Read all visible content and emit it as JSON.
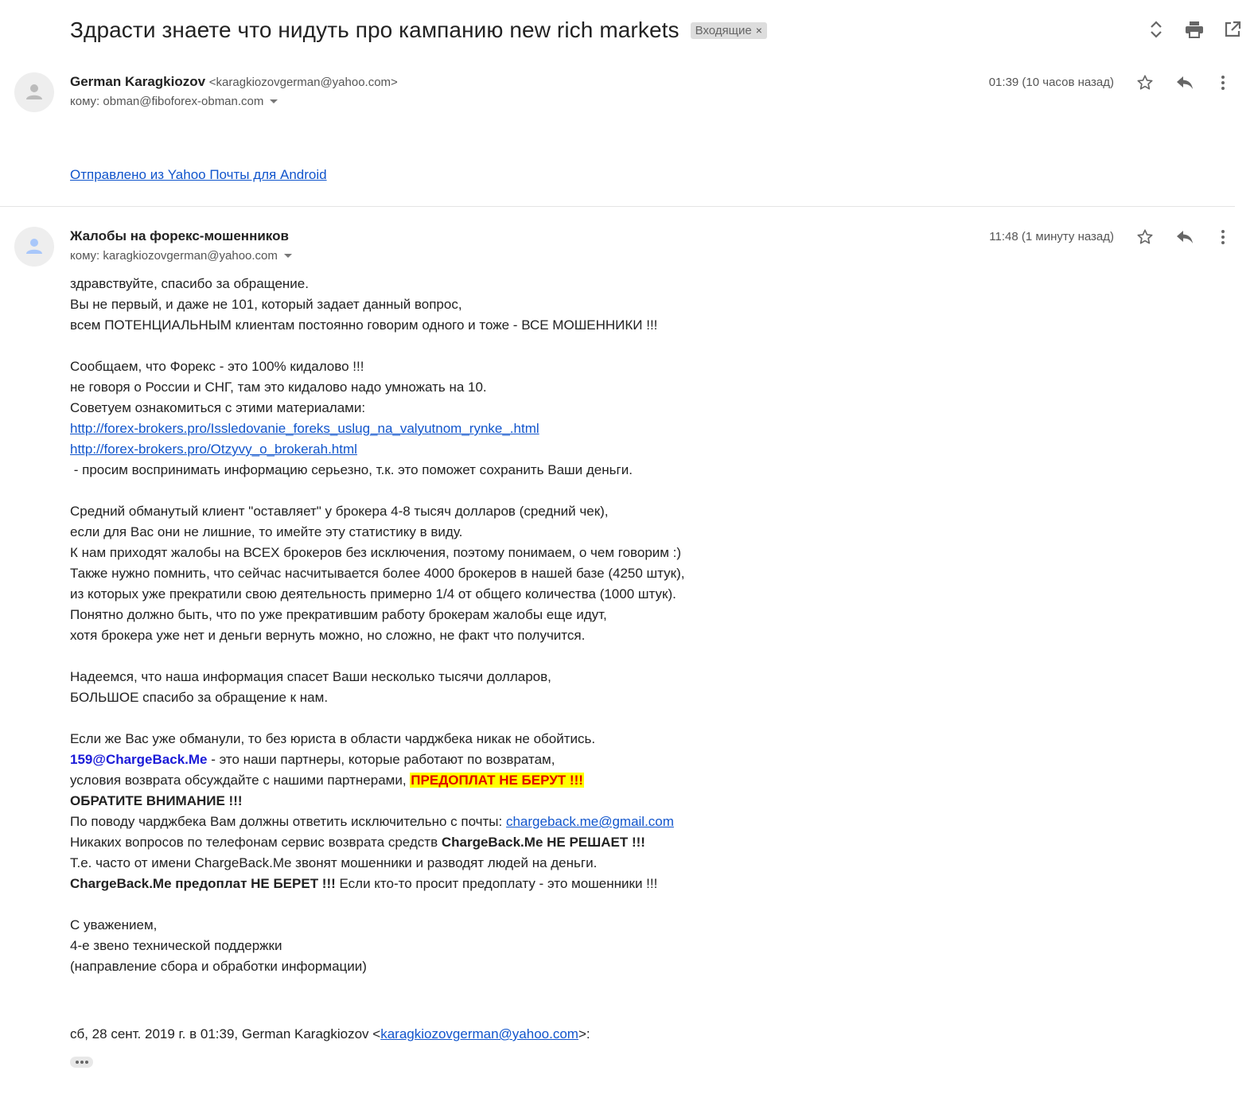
{
  "subject": "Здрасти знаете что нидуть про кампанию new rich markets",
  "label": "Входящие",
  "label_close": "×",
  "messages": [
    {
      "sender_name": "German Karagkiozov",
      "sender_email": "<karagkiozovgerman@yahoo.com>",
      "to": "кому: obman@fiboforex-obman.com",
      "time": "01:39 (10 часов назад)",
      "body_link": "Отправлено из Yahoo Почты для Android"
    },
    {
      "sender_name": "Жалобы на форекс-мошенников",
      "to": "кому: karagkiozovgerman@yahoo.com",
      "time": "11:48 (1 минуту назад)",
      "lines": {
        "l1": "здравствуйте, спасибо за обращение.",
        "l2": "Вы не первый, и даже не 101, который задает данный вопрос,",
        "l3": "всем ПОТЕНЦИАЛЬНЫМ клиентам постоянно говорим одного и тоже - ВСЕ МОШЕННИКИ !!!",
        "l4": "Сообщаем, что Форекс - это 100% кидалово !!!",
        "l5": "не говоря о России и СНГ, там это кидалово надо умножать на 10.",
        "l6": "Советуем ознакомиться с этими материалами:",
        "link1": "http://forex-brokers.pro/Issledovanie_foreks_uslug_na_valyutnom_rynke_.html",
        "link2": "http://forex-brokers.pro/Otzyvy_o_brokerah.html",
        "l7": " - просим воспринимать информацию серьезно, т.к. это поможет сохранить Ваши деньги.",
        "l8": "Средний обманутый клиент \"оставляет\" у брокера 4-8 тысяч долларов (средний чек),",
        "l9": "если для Вас они не лишние, то имейте эту статистику в виду.",
        "l10": "К нам приходят жалобы на ВСЕХ брокеров без исключения, поэтому понимаем, о чем говорим :)",
        "l11": "Также нужно помнить, что сейчас насчитывается более 4000 брокеров в нашей базе (4250 штук),",
        "l12": "из которых уже прекратили свою деятельность примерно 1/4 от общего количества (1000 штук).",
        "l13": "Понятно должно быть, что по уже прекратившим работу брокерам жалобы еще идут,",
        "l14": "хотя брокера уже нет и деньги вернуть можно, но сложно, не факт что получится.",
        "l15": "Надеемся, что наша информация спасет Ваши несколько тысячи долларов,",
        "l16": "БОЛЬШОЕ спасибо за обращение к нам.",
        "l17": "Если же Вас уже обманули, то без юриста в области чарджбека никак не обойтись.",
        "l18a": "159@ChargeBack.Me",
        "l18b": " - это наши партнеры, которые работают по возвратам,",
        "l19a": "условия возврата обсуждайте с нашими партнерами, ",
        "l19b": "ПРЕДОПЛАТ НЕ БЕРУТ !!!",
        "l20": "ОБРАТИТЕ ВНИМАНИЕ !!!",
        "l21a": "По поводу чарджбека Вам должны ответить исключительно с почты: ",
        "l21b": "chargeback.me@gmail.com",
        "l22a": "Никаких вопросов по телефонам сервис возврата средств ",
        "l22b": "ChargeBack.Me НЕ РЕШАЕТ !!!",
        "l23": "Т.е. часто от имени ChargeBack.Me звонят мошенники и разводят людей на деньги.",
        "l24a": "ChargeBack.Me предоплат НЕ БЕРЕТ !!!",
        "l24b": " Если кто-то просит предоплату - это мошенники !!!",
        "l25": "С уважением,",
        "l26": "4-е звено технической поддержки",
        "l27": "(направление сбора и обработки информации)",
        "q1": "сб, 28 сент. 2019 г. в 01:39, German Karagkiozov <",
        "q2": "karagkiozovgerman@yahoo.com",
        "q3": ">:"
      }
    }
  ],
  "colors": {
    "link": "#1155cc",
    "highlight_bg": "#ffff00",
    "highlight_text": "#e00000",
    "partner_blue": "#1a1ad8",
    "avatar_default": "#bbbbbb",
    "avatar_blue": "#a8c7fa"
  },
  "icons": [
    "expand-collapse-icon",
    "print-icon",
    "open-new-window-icon",
    "star-icon",
    "reply-icon",
    "more-vert-icon",
    "avatar-person-icon"
  ]
}
